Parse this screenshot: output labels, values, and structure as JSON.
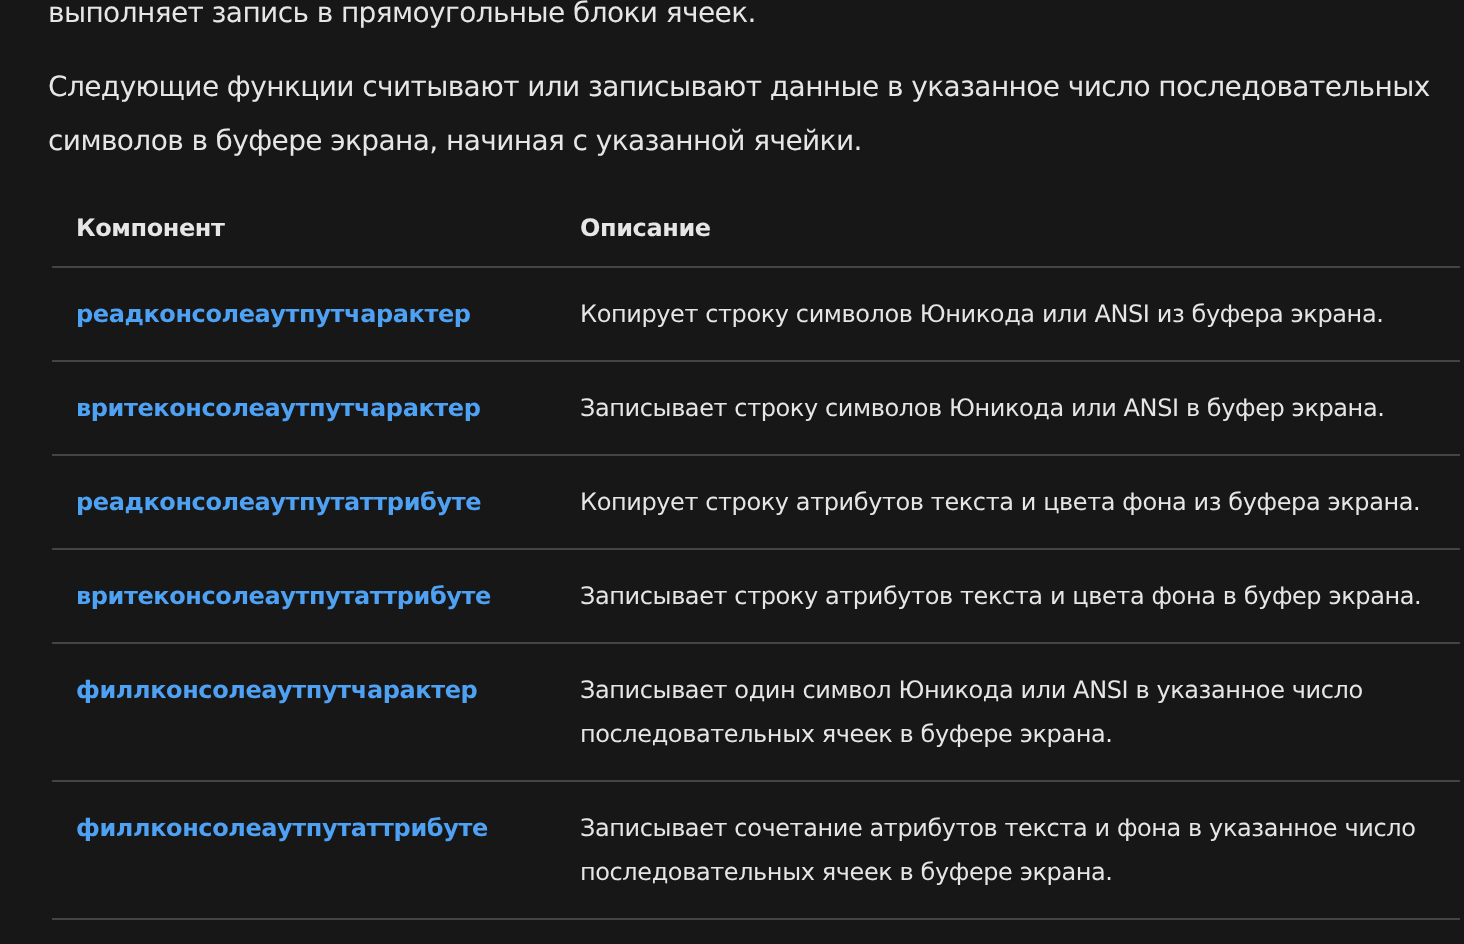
{
  "paragraphs": [
    "выполняет запись в прямоугольные блоки ячеек.",
    "Следующие функции считывают или записывают данные в указанное число последовательных символов в буфере экрана, начиная с указанной ячейки."
  ],
  "table": {
    "columns": [
      "Компонент",
      "Описание"
    ],
    "rows": [
      {
        "function": "реадконсолеаутпутчарактер",
        "description": "Копирует строку символов Юникода или ANSI из буфера экрана."
      },
      {
        "function": "вритеконсолеаутпутчарактер",
        "description": "Записывает строку символов Юникода или ANSI в буфер экрана."
      },
      {
        "function": "реадконсолеаутпутаттрибуте",
        "description": "Копирует строку атрибутов текста и цвета фона из буфера экрана."
      },
      {
        "function": "вритеконсолеаутпутаттрибуте",
        "description": "Записывает строку атрибутов текста и цвета фона в буфер экрана."
      },
      {
        "function": "филлконсолеаутпутчарактер",
        "description": "Записывает один символ Юникода или ANSI в указанное число последовательных ячеек в буфере экрана."
      },
      {
        "function": "филлконсолеаутпутаттрибуте",
        "description": "Записывает сочетание атрибутов текста и фона в указанное число последовательных ячеек в буфере экрана."
      }
    ]
  }
}
